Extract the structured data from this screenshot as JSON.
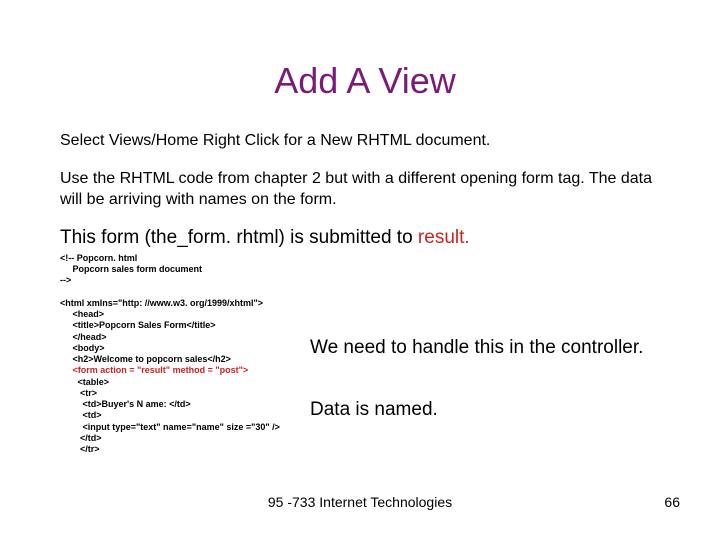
{
  "title": "Add A View",
  "para1": "Select Views/Home Right Click for a New RHTML document.",
  "para2": "Use the RHTML code from chapter 2 but with a different opening form tag. The data will be arriving with names on the form.",
  "bigline_pre": "This form (the_form. rhtml) is submitted to ",
  "bigline_key": "result.",
  "code_block1": "<!-- Popcorn. html\n     Popcorn sales form document\n-->\n\n<html xmlns=\"http: //www.w3. org/1999/xhtml\">\n     <head>\n     <title>Popcorn Sales Form</title>\n     </head>\n     <body>\n     <h2>Welcome to popcorn sales</h2>\n     ",
  "code_red": "<form action = \"result\" method = \"post\">",
  "code_block2": "\n       <table>\n        <tr>\n         <td>Buyer's N ame: </td>\n         <td>\n         <input type=\"text\" name=\"name\" size =\"30\" />\n        </td>\n        </tr>",
  "note1": "We need to handle this in the controller.",
  "note2": "Data is named.",
  "footer_center": "95 -733 Internet Technologies",
  "footer_page": "66"
}
